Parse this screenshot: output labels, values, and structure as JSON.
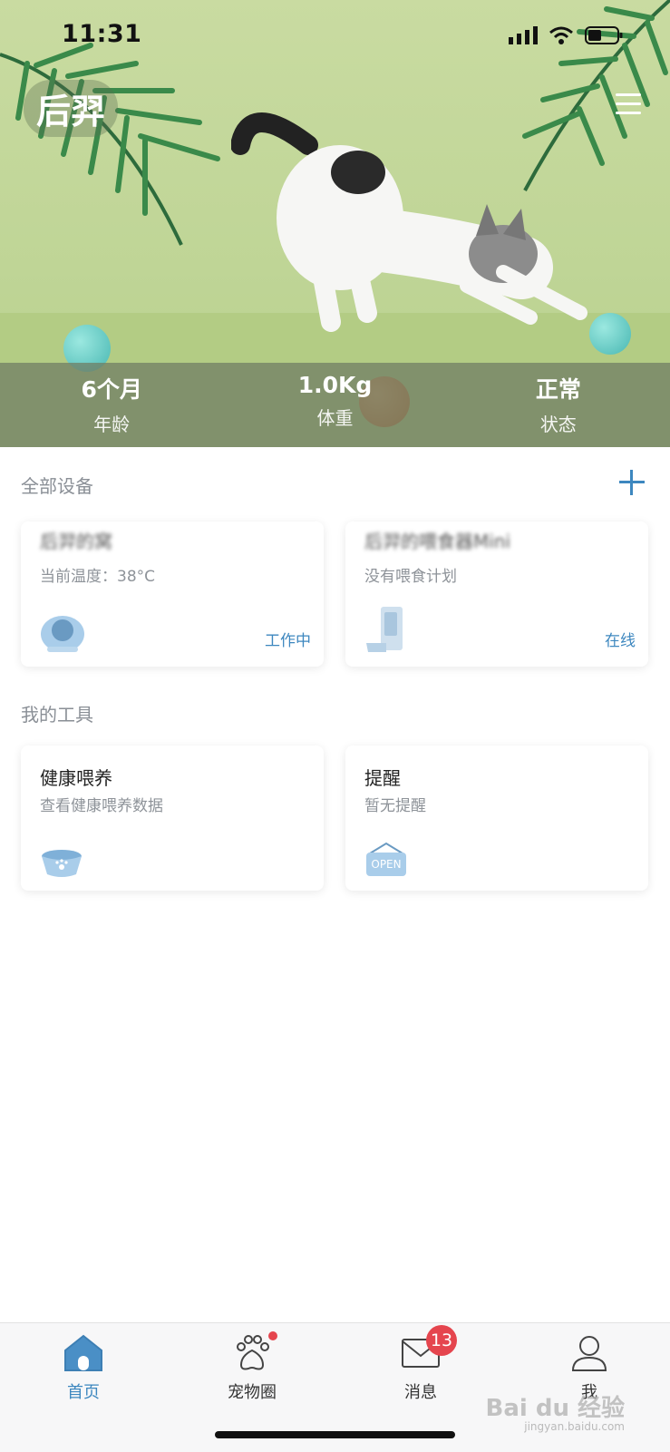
{
  "status_bar": {
    "time": "11:31"
  },
  "header": {
    "pet_name": "后羿"
  },
  "stats": [
    {
      "value": "6个月",
      "label": "年龄"
    },
    {
      "value": "1.0Kg",
      "label": "体重"
    },
    {
      "value": "正常",
      "label": "状态"
    }
  ],
  "devices": {
    "title": "全部设备",
    "items": [
      {
        "name": "后羿的窝",
        "subtitle": "当前温度：38°C",
        "status": "工作中",
        "icon": "heated-bed-icon"
      },
      {
        "name": "后羿的喂食器Mini",
        "subtitle": "没有喂食计划",
        "status": "在线",
        "icon": "feeder-icon"
      }
    ]
  },
  "tools": {
    "title": "我的工具",
    "items": [
      {
        "name": "健康喂养",
        "subtitle": "查看健康喂养数据",
        "icon": "pet-bowl-icon"
      },
      {
        "name": "提醒",
        "subtitle": "暂无提醒",
        "icon": "open-sign-icon",
        "icon_text": "OPEN"
      }
    ]
  },
  "tabbar": {
    "items": [
      {
        "label": "首页",
        "icon": "home-icon",
        "active": true
      },
      {
        "label": "宠物圈",
        "icon": "paw-icon"
      },
      {
        "label": "消息",
        "icon": "envelope-icon",
        "badge": "13"
      },
      {
        "label": "我",
        "icon": "user-icon"
      }
    ]
  },
  "watermark": {
    "text": "Bai du 经验",
    "sub": "jingyan.baidu.com"
  },
  "colors": {
    "accent": "#3d87bf",
    "badge": "#e5454e",
    "hero_bg": "#c3d79a"
  }
}
